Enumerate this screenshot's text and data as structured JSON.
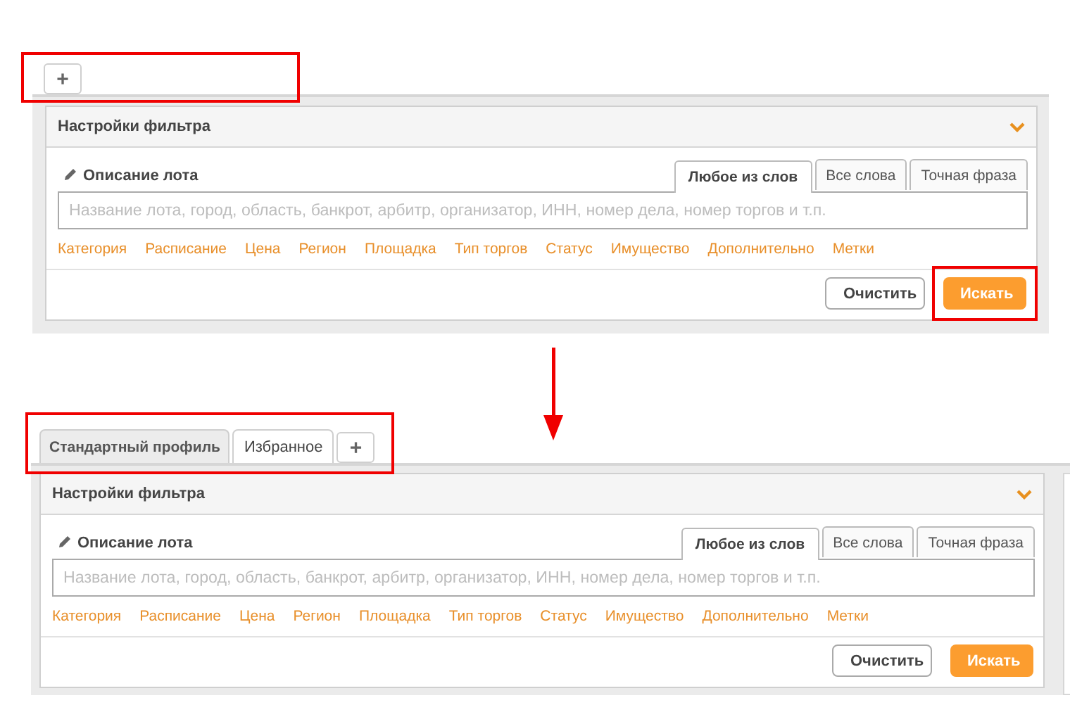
{
  "profiles": [
    {
      "tab_bar_highlighted": true,
      "tabs": [
        {
          "kind": "add",
          "label": "+"
        }
      ],
      "panel": {
        "title": "Настройки фильтра",
        "field_label": "Описание лота",
        "match_modes": [
          {
            "label": "Любое из слов",
            "selected": true
          },
          {
            "label": "Все слова",
            "selected": false
          },
          {
            "label": "Точная фраза",
            "selected": false
          }
        ],
        "placeholder": "Название лота, город, область, банкрот, арбитр, организатор, ИНН, номер дела, номер торгов и т.п.",
        "filter_links": [
          "Категория",
          "Расписание",
          "Цена",
          "Регион",
          "Площадка",
          "Тип торгов",
          "Статус",
          "Имущество",
          "Дополнительно",
          "Метки"
        ],
        "buttons": [
          {
            "kind": "secondary",
            "label": "Очистить",
            "highlighted": false
          },
          {
            "kind": "primary",
            "label": "Искать",
            "highlighted": true
          }
        ]
      }
    },
    {
      "tab_bar_highlighted": true,
      "tabs": [
        {
          "kind": "tab",
          "label": "Стандартный профиль",
          "selected": true
        },
        {
          "kind": "tab",
          "label": "Избранное",
          "selected": false
        },
        {
          "kind": "add",
          "label": "+"
        }
      ],
      "panel": {
        "title": "Настройки фильтра",
        "field_label": "Описание лота",
        "match_modes": [
          {
            "label": "Любое из слов",
            "selected": true
          },
          {
            "label": "Все слова",
            "selected": false
          },
          {
            "label": "Точная фраза",
            "selected": false
          }
        ],
        "placeholder": "Название лота, город, область, банкрот, арбитр, организатор, ИНН, номер дела, номер торгов и т.п.",
        "filter_links": [
          "Категория",
          "Расписание",
          "Цена",
          "Регион",
          "Площадка",
          "Тип торгов",
          "Статус",
          "Имущество",
          "Дополнительно",
          "Метки"
        ],
        "buttons": [
          {
            "kind": "secondary",
            "label": "Очистить",
            "highlighted": false
          },
          {
            "kind": "primary",
            "label": "Искать",
            "highlighted": false
          }
        ]
      }
    }
  ]
}
